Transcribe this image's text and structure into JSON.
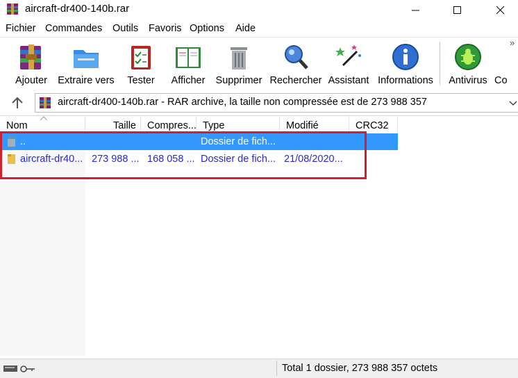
{
  "window": {
    "title": "aircraft-dr400-140b.rar",
    "icon": "winrar-icon"
  },
  "menu": [
    "Fichier",
    "Commandes",
    "Outils",
    "Favoris",
    "Options",
    "Aide"
  ],
  "toolbar": [
    {
      "label": "Ajouter",
      "icon": "add-archive-icon"
    },
    {
      "label": "Extraire vers",
      "icon": "extract-folder-icon"
    },
    {
      "label": "Tester",
      "icon": "test-clipboard-icon"
    },
    {
      "label": "Afficher",
      "icon": "view-book-icon"
    },
    {
      "label": "Supprimer",
      "icon": "delete-bin-icon"
    },
    {
      "label": "Rechercher",
      "icon": "find-magnifier-icon"
    },
    {
      "label": "Assistant",
      "icon": "wizard-wand-icon"
    },
    {
      "label": "Informations",
      "icon": "info-icon"
    },
    {
      "label": "Antivirus",
      "icon": "antivirus-bug-icon"
    },
    {
      "label": "Co",
      "icon": "comment-icon"
    }
  ],
  "address": {
    "text": "aircraft-dr400-140b.rar - RAR archive, la taille non compressée est de 273 988 357"
  },
  "columns": [
    "Nom",
    "Taille",
    "Compres...",
    "Type",
    "Modifié",
    "CRC32"
  ],
  "rows": [
    {
      "name": "..",
      "size": "",
      "packed": "",
      "type": "Dossier de fich...",
      "modified": "",
      "crc": "",
      "selected": true
    },
    {
      "name": "aircraft-dr40...",
      "size": "273 988 ...",
      "packed": "168 058 ...",
      "type": "Dossier de fich...",
      "modified": "21/08/2020...",
      "crc": "",
      "selected": false
    }
  ],
  "status": {
    "text": "Total 1 dossier, 273 988 357 octets"
  },
  "colors": {
    "selection": "#3399ff",
    "annotation_box": "#d0202f",
    "row_text": "#2a2acc"
  }
}
